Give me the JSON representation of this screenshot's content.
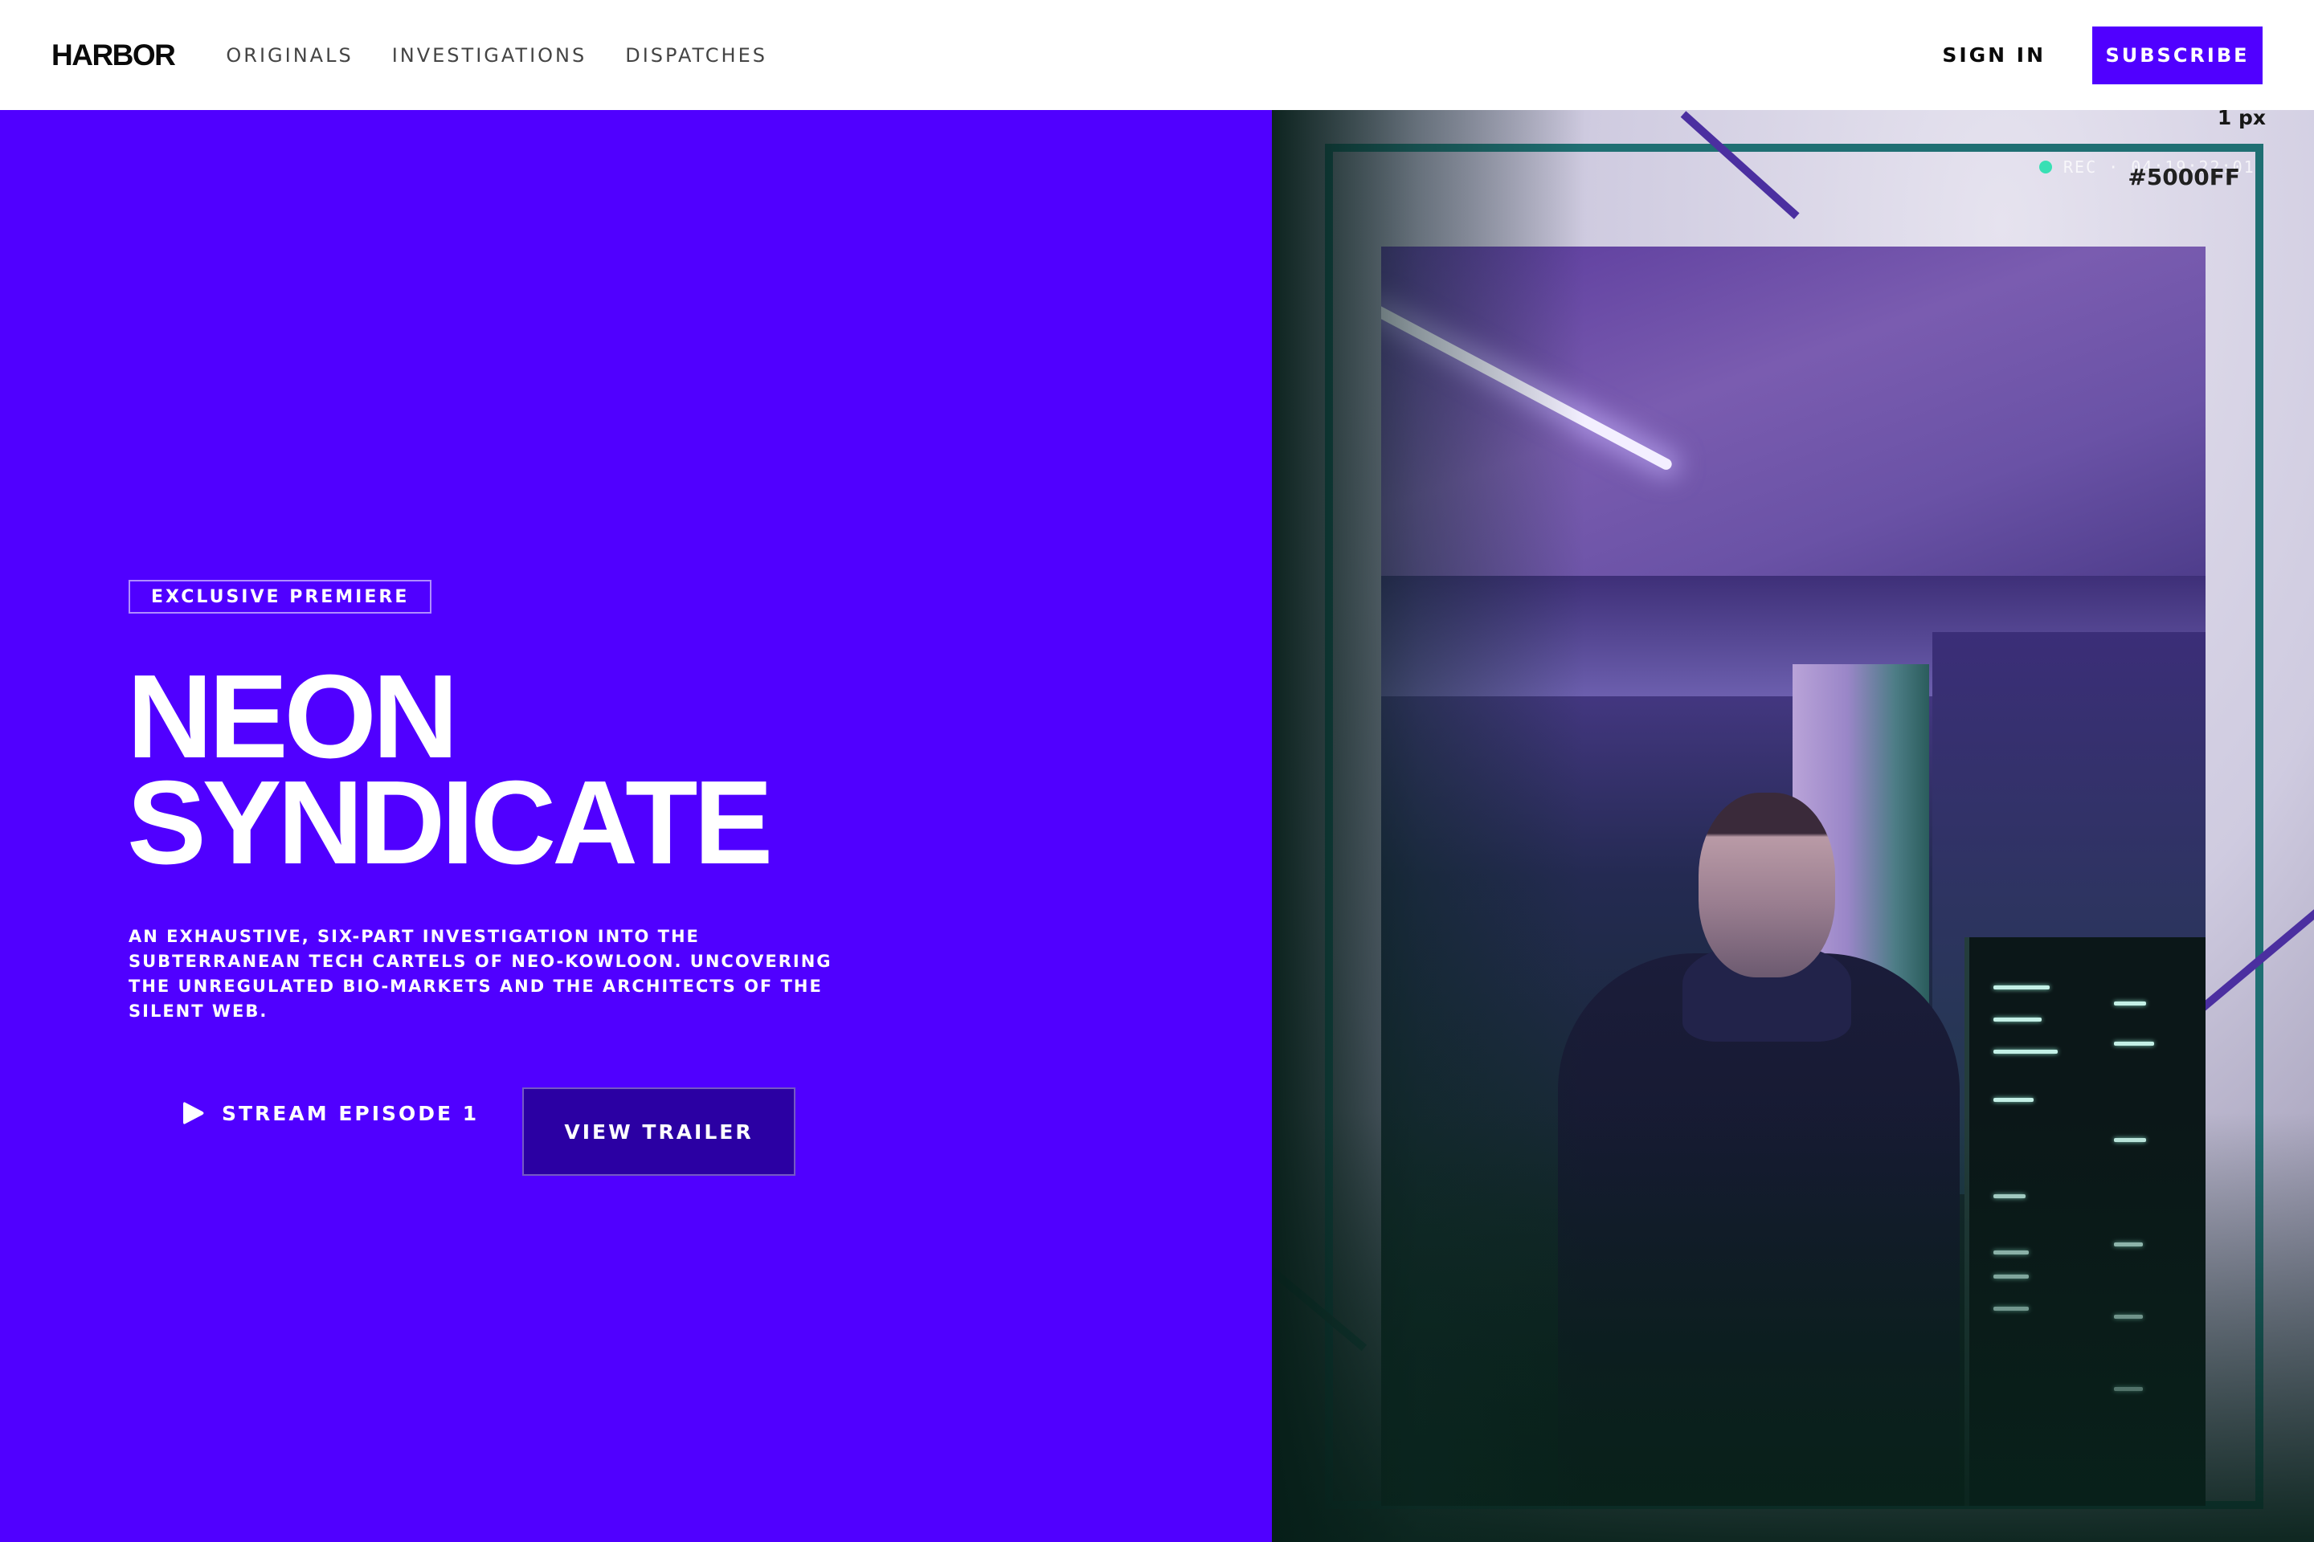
{
  "header": {
    "logo": "HARBOR",
    "nav": [
      "ORIGINALS",
      "INVESTIGATIONS",
      "DISPATCHES"
    ],
    "sign_in": "SIGN IN",
    "subscribe": "SUBSCRIBE"
  },
  "hero": {
    "badge": "EXCLUSIVE PREMIERE",
    "title_line1": "NEON",
    "title_line2": "SYNDICATE",
    "description": "AN EXHAUSTIVE, SIX-PART INVESTIGATION INTO THE SUBTERRANEAN TECH CARTELS OF NEO-KOWLOON. UNCOVERING THE UNREGULATED BIO-MARKETS AND THE ARCHITECTS OF THE SILENT WEB.",
    "stream_button": "STREAM EPISODE 1",
    "trailer_button": "VIEW TRAILER"
  },
  "visual": {
    "stroke_label": "1 px",
    "rec_label": "REC · 04:19:22:01",
    "color_label": "#5000FF",
    "image_alt": "Man in dark jacket standing in a purple-lit concrete server room"
  },
  "colors": {
    "accent": "#5000ff",
    "accent_dark": "#2b00a3",
    "frame_teal": "#1f6f73",
    "rec_dot": "#38e0b4"
  },
  "icons": {
    "play": "play-icon"
  }
}
